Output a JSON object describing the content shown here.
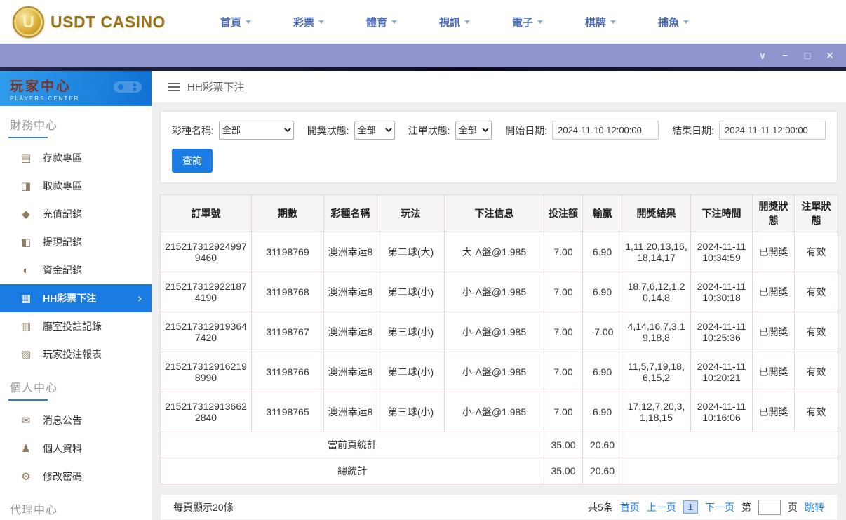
{
  "colors": {
    "accent": "#1a7be2",
    "titlebar": "#9193ce",
    "sidebar_header_blue": "#1173d4",
    "brand_gold": "#97741f",
    "table_border": "#e9d2d2"
  },
  "header": {
    "brand": "USDT CASINO",
    "brand_initial": "U",
    "nav_items": [
      {
        "label": "首頁"
      },
      {
        "label": "彩票"
      },
      {
        "label": "體育"
      },
      {
        "label": "視訊"
      },
      {
        "label": "電子"
      },
      {
        "label": "棋牌"
      },
      {
        "label": "捕魚"
      }
    ]
  },
  "titlebar": {
    "chevron": "∨",
    "minimize": "−",
    "maximize": "□",
    "close": "×"
  },
  "sidebar": {
    "title": "玩家中心",
    "subtitle": "PLAYERS CENTER",
    "sections": [
      {
        "title": "財務中心",
        "items": [
          {
            "id": "deposit",
            "label": "存款專區",
            "icon": "deposit-icon",
            "glyph": "▤"
          },
          {
            "id": "withdraw",
            "label": "取款專區",
            "icon": "withdraw-icon",
            "glyph": "◨"
          },
          {
            "id": "recharge-records",
            "label": "充值記錄",
            "icon": "recharge-record-icon",
            "glyph": "◆"
          },
          {
            "id": "withdraw-records",
            "label": "提現記錄",
            "icon": "withdraw-record-icon",
            "glyph": "◧"
          },
          {
            "id": "funds-records",
            "label": "資金記錄",
            "icon": "funds-record-icon",
            "glyph": "◐"
          },
          {
            "id": "hh-lottery-bets",
            "label": "HH彩票下注",
            "icon": "lottery-bet-icon",
            "glyph": "▦",
            "active": true,
            "chevron": "›"
          },
          {
            "id": "hall-bet-records",
            "label": "廳室投註記錄",
            "icon": "hall-record-icon",
            "glyph": "▥"
          },
          {
            "id": "player-bet-report",
            "label": "玩家投注報表",
            "icon": "report-icon",
            "glyph": "▧"
          }
        ]
      },
      {
        "title": "個人中心",
        "items": [
          {
            "id": "announcements",
            "label": "消息公告",
            "icon": "bell-icon",
            "glyph": "✉"
          },
          {
            "id": "profile",
            "label": "個人資料",
            "icon": "person-icon",
            "glyph": "♟"
          },
          {
            "id": "change-password",
            "label": "修改密碼",
            "icon": "gear-icon",
            "glyph": "⚙"
          }
        ]
      },
      {
        "title": "代理中心",
        "items": []
      }
    ]
  },
  "breadcrumb": {
    "title": "HH彩票下注"
  },
  "filters": {
    "lottery_label": "彩種名稱:",
    "lottery_value": "全部",
    "draw_status_label": "開獎狀態:",
    "draw_status_value": "全部",
    "order_status_label": "注單狀態:",
    "order_status_value": "全部",
    "start_label": "開始日期:",
    "start_value": "2024-11-10 12:00:00",
    "end_label": "結束日期:",
    "end_value": "2024-11-11 12:00:00",
    "search_label": "查詢"
  },
  "table": {
    "headers": [
      "訂單號",
      "期數",
      "彩種名稱",
      "玩法",
      "下注信息",
      "投注額",
      "輸贏",
      "開獎結果",
      "下注時間",
      "開獎狀態",
      "注單狀態"
    ],
    "rows": [
      [
        "2152173129249979460",
        "31198769",
        "澳洲幸运8",
        "第二球(大)",
        "大-A盤@1.985",
        "7.00",
        "6.90",
        "1,11,20,13,16,18,14,17",
        "2024-11-11 10:34:59",
        "已開獎",
        "有效"
      ],
      [
        "2152173129221874190",
        "31198768",
        "澳洲幸运8",
        "第二球(小)",
        "小-A盤@1.985",
        "7.00",
        "6.90",
        "18,7,6,12,1,20,14,8",
        "2024-11-11 10:30:18",
        "已開獎",
        "有效"
      ],
      [
        "2152173129193647420",
        "31198767",
        "澳洲幸运8",
        "第三球(小)",
        "小-A盤@1.985",
        "7.00",
        "-7.00",
        "4,14,16,7,3,19,18,8",
        "2024-11-11 10:25:36",
        "已開獎",
        "有效"
      ],
      [
        "2152173129162198990",
        "31198766",
        "澳洲幸运8",
        "第二球(小)",
        "小-A盤@1.985",
        "7.00",
        "6.90",
        "11,5,7,19,18,6,15,2",
        "2024-11-11 10:20:21",
        "已開獎",
        "有效"
      ],
      [
        "2152173129136622840",
        "31198765",
        "澳洲幸运8",
        "第三球(小)",
        "小-A盤@1.985",
        "7.00",
        "6.90",
        "17,12,7,20,3,1,18,15",
        "2024-11-11 10:16:06",
        "已開獎",
        "有效"
      ]
    ],
    "summary": [
      {
        "label": "當前頁統計",
        "bet_total": "35.00",
        "winloss_total": "20.60"
      },
      {
        "label": "總統計",
        "bet_total": "35.00",
        "winloss_total": "20.60"
      }
    ]
  },
  "pagination": {
    "page_size_text": "每頁顯示20條",
    "total_text": "共5条",
    "first": "首页",
    "prev": "上一页",
    "current": "1",
    "next": "下一页",
    "jump_prefix": "第",
    "jump_suffix": "页",
    "jump": "跳转"
  }
}
